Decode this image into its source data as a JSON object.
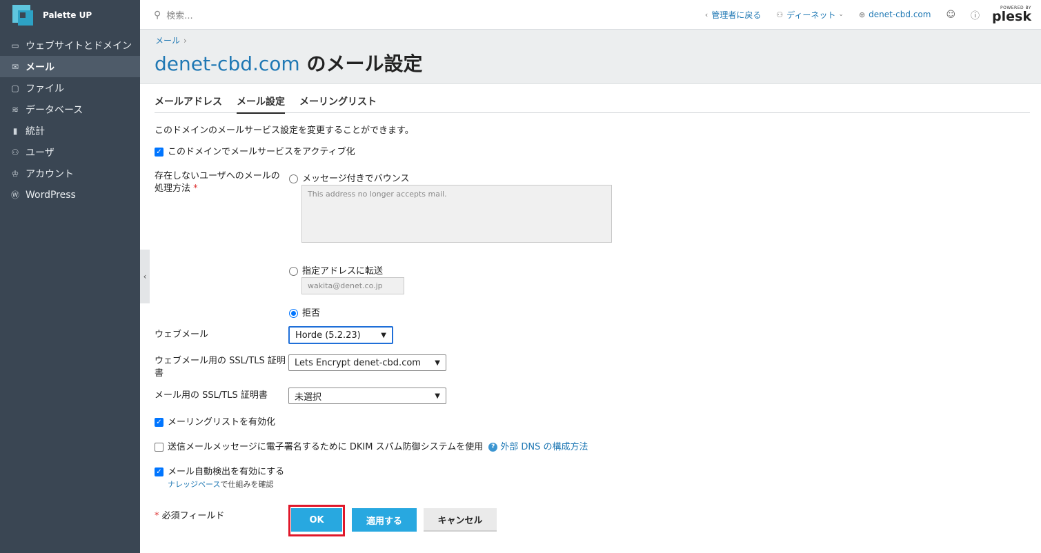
{
  "brand": {
    "name": "Palette UP"
  },
  "sidebar": {
    "items": [
      {
        "label": "ウェブサイトとドメイン",
        "icon": "monitor-icon"
      },
      {
        "label": "メール",
        "icon": "mail-icon",
        "active": true
      },
      {
        "label": "ファイル",
        "icon": "folder-icon"
      },
      {
        "label": "データベース",
        "icon": "database-icon"
      },
      {
        "label": "統計",
        "icon": "chart-icon"
      },
      {
        "label": "ユーザ",
        "icon": "user-icon"
      },
      {
        "label": "アカウント",
        "icon": "account-icon"
      },
      {
        "label": "WordPress",
        "icon": "wordpress-icon"
      }
    ]
  },
  "topbar": {
    "search_placeholder": "検索...",
    "back_admin": "管理者に戻る",
    "user": "ディーネット",
    "domain": "denet-cbd.com",
    "powered_by": "POWERED BY",
    "plesk": "plesk"
  },
  "header": {
    "breadcrumb": "メール",
    "title_domain": "denet-cbd.com",
    "title_suffix": " のメール設定"
  },
  "tabs": [
    "メールアドレス",
    "メール設定",
    "メーリングリスト"
  ],
  "form": {
    "intro": "このドメインのメールサービス設定を変更することができます。",
    "activate_label": "このドメインでメールサービスをアクティブ化",
    "nonexistent_label_1": "存在しないユーザへのメールの",
    "nonexistent_label_2": "処理方法",
    "required_mark": "*",
    "bounce_label": "メッセージ付きでバウンス",
    "bounce_message": "This address no longer accepts mail.",
    "forward_label": "指定アドレスに転送",
    "forward_address": "wakita@denet.co.jp",
    "reject_label": "拒否",
    "webmail_label": "ウェブメール",
    "webmail_value": "Horde (5.2.23)",
    "webmail_ssl_label_1": "ウェブメール用の SSL/TLS 証明",
    "webmail_ssl_label_2": "書",
    "webmail_ssl_value": "Lets Encrypt denet-cbd.com",
    "mail_ssl_label": "メール用の SSL/TLS 証明書",
    "mail_ssl_value": "未選択",
    "mailing_list_label": "メーリングリストを有効化",
    "dkim_label": "送信メールメッセージに電子署名するために DKIM スパム防御システムを使用",
    "dkim_help_link": "外部 DNS の構成方法",
    "autodiscover_label": "メール自動検出を有効にする",
    "kb_link": "ナレッジベース",
    "kb_suffix": "で仕組みを確認",
    "required_note": "必須フィールド"
  },
  "buttons": {
    "ok": "OK",
    "apply": "適用する",
    "cancel": "キャンセル"
  },
  "colors": {
    "accent": "#1f78b4",
    "primary_button": "#28a8e0",
    "highlight": "#e0182a",
    "sidebar": "#3a4653"
  }
}
